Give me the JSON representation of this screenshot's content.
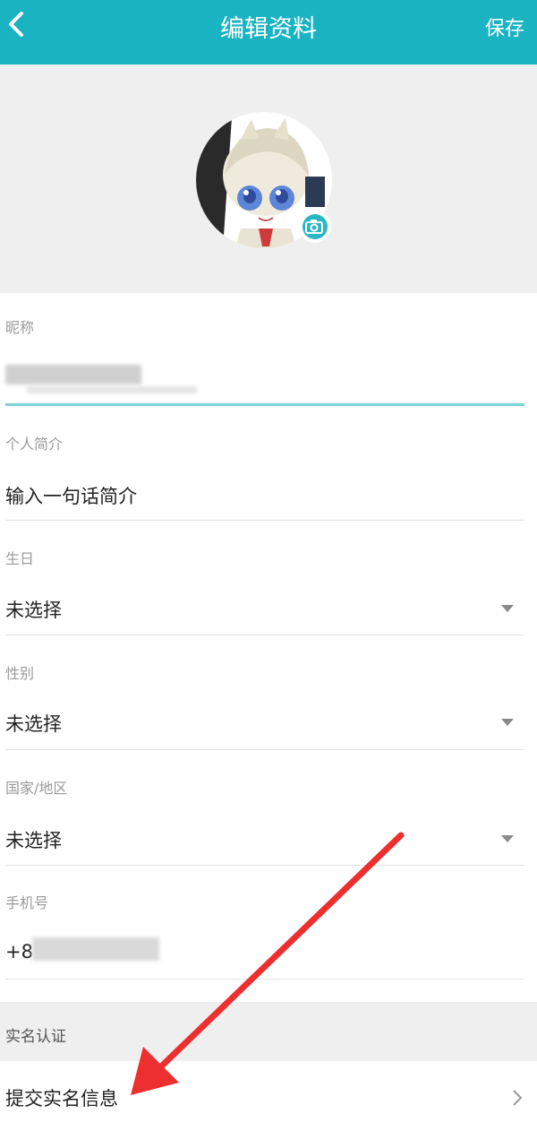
{
  "header": {
    "title": "编辑资料",
    "save_label": "保存",
    "background": "#19b3c2"
  },
  "fields": [
    {
      "label": "昵称",
      "value": ""
    },
    {
      "label": "个人简介",
      "value": "输入一句话简介"
    },
    {
      "label": "生日",
      "value": "未选择"
    },
    {
      "label": "性别",
      "value": "未选择"
    },
    {
      "label": "国家/地区",
      "value": "未选择"
    },
    {
      "label": "手机号",
      "value": "+8"
    }
  ],
  "real_name": {
    "section_title": "实名认证",
    "submit_label": "提交实名信息"
  },
  "icons": {
    "back": "chevron-left-icon",
    "camera": "camera-icon",
    "dropdown": "triangle-down-icon",
    "chevron": "chevron-right-icon"
  },
  "annotation": {
    "color": "#ee2f2f"
  }
}
